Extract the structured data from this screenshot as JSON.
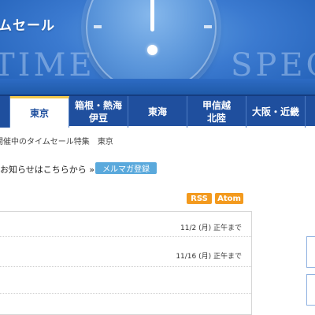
{
  "banner": {
    "title": "ムセール",
    "deco_left": "TIME",
    "deco_right": "SPECIA"
  },
  "nav": {
    "tabs": [
      {
        "label": "東京",
        "sub": "",
        "active": true
      },
      {
        "label": "箱根・熱海",
        "sub": "伊豆",
        "active": false
      },
      {
        "label": "東海",
        "sub": "",
        "active": false
      },
      {
        "label": "甲信越",
        "sub": "北陸",
        "active": false
      },
      {
        "label": "大阪・近畿",
        "sub": "",
        "active": false
      }
    ]
  },
  "breadcrumb": {
    "current_page": "開催中のタイムセール特集",
    "area": "東京"
  },
  "notice": {
    "text": "お知らせはこちらから »",
    "mailmag_button": "メルマガ登録"
  },
  "feeds": {
    "rss": "RSS",
    "atom": "Atom"
  },
  "sales": [
    {
      "deadline": "11/2 (月) 正午まで"
    },
    {
      "deadline": "11/16 (月) 正午まで"
    },
    {
      "deadline": ""
    }
  ],
  "colors": {
    "nav_bg": "#1f4f9e",
    "active_tab_accent": "#f2c94c",
    "mailmag_button": "#5aa9dc",
    "feed_badge": "#f39a1e"
  }
}
